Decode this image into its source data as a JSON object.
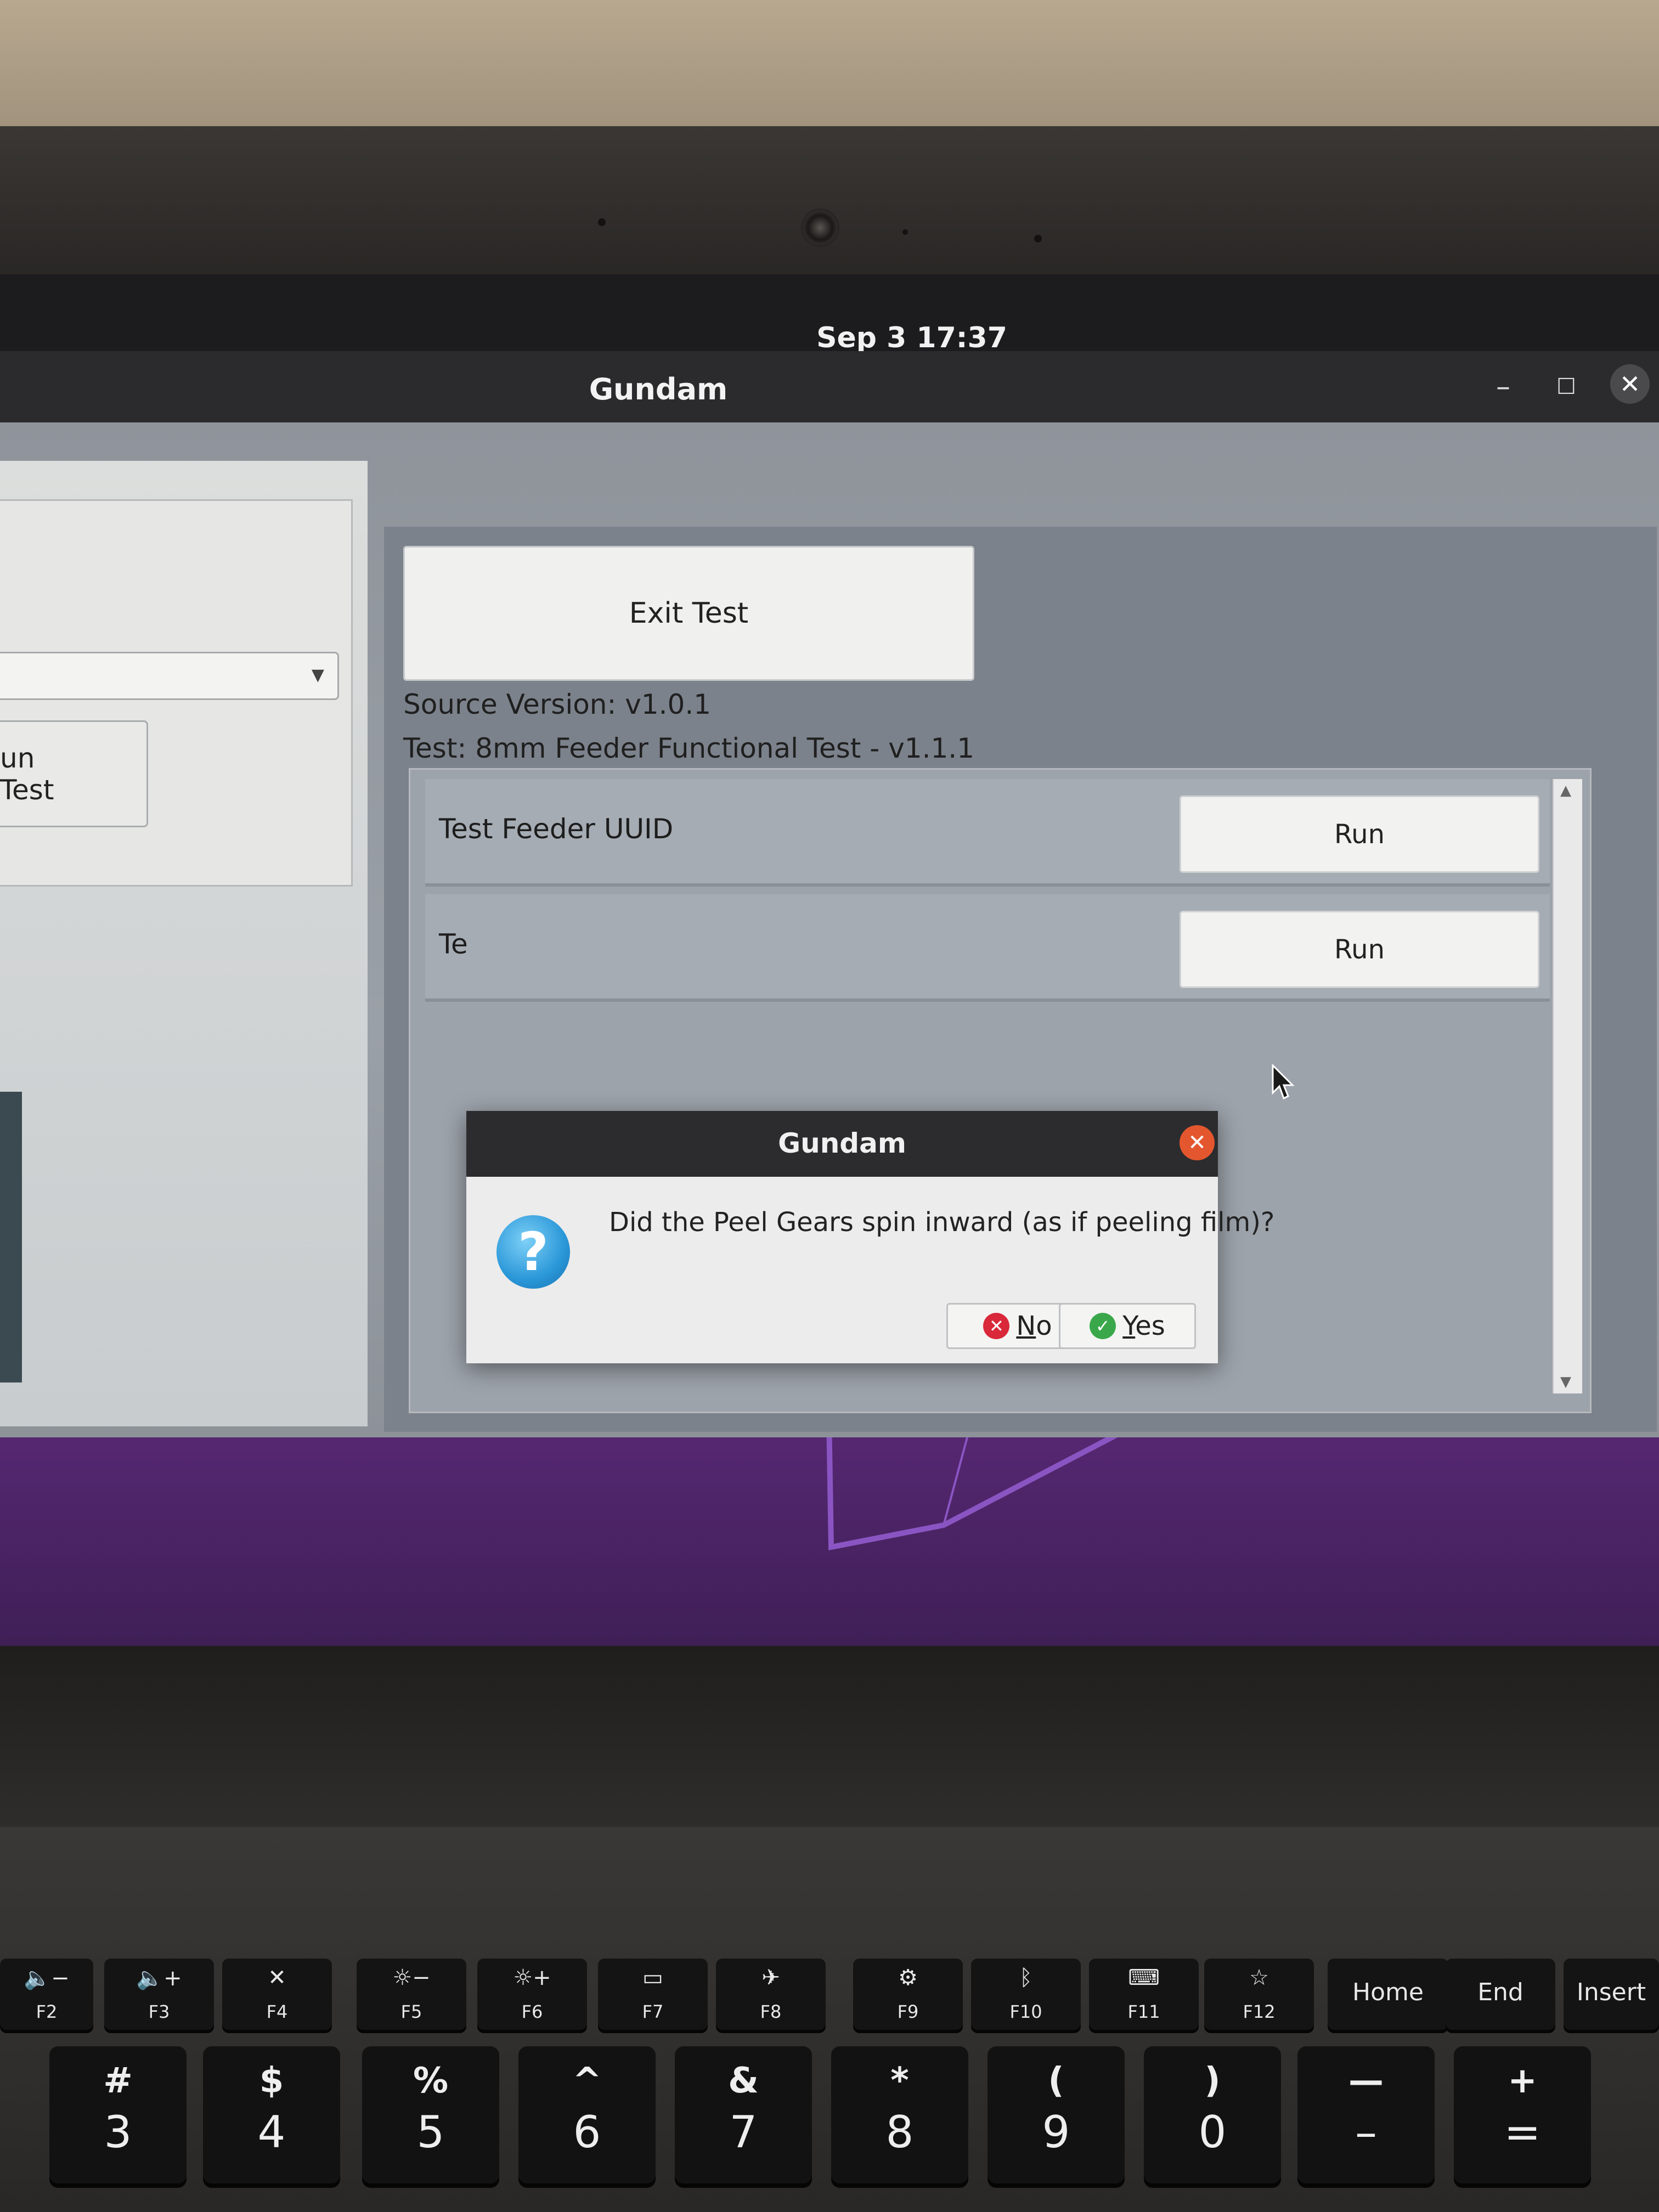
{
  "system": {
    "clock": "Sep 3  17:37"
  },
  "window": {
    "title": "Gundam",
    "controls": {
      "minimize": "–",
      "maximize": "☐",
      "close": "✕"
    }
  },
  "left_panel": {
    "run_test_label": "un Test"
  },
  "right_panel": {
    "exit_button": "Exit Test",
    "source_version": "Source Version: v1.0.1",
    "test_name": "Test: 8mm Feeder Functional Test - v1.1.1",
    "tests": [
      {
        "label": "Test Feeder UUID",
        "button": "Run"
      },
      {
        "label": "Te",
        "button": "Run"
      }
    ]
  },
  "dialog": {
    "title": "Gundam",
    "message": "Did the Peel Gears spin inward (as if peeling film)?",
    "no_button": {
      "mnemonic": "N",
      "rest": "o"
    },
    "yes_button": {
      "mnemonic": "Y",
      "rest": "es"
    }
  },
  "keyboard": {
    "function_keys": [
      {
        "icon": "🔈−",
        "label": "F2"
      },
      {
        "icon": "🔈+",
        "label": "F3"
      },
      {
        "icon": "✕",
        "label": "F4"
      },
      {
        "icon": "☼−",
        "label": "F5"
      },
      {
        "icon": "☼+",
        "label": "F6"
      },
      {
        "icon": "▭",
        "label": "F7"
      },
      {
        "icon": "✈",
        "label": "F8"
      },
      {
        "icon": "⚙",
        "label": "F9"
      },
      {
        "icon": "ᛒ",
        "label": "F10"
      },
      {
        "icon": "⌨",
        "label": "F11"
      },
      {
        "icon": "☆",
        "label": "F12"
      }
    ],
    "nav_keys": [
      "Home",
      "End",
      "Insert"
    ],
    "number_keys": [
      {
        "shift": "#",
        "main": "3"
      },
      {
        "shift": "$",
        "main": "4"
      },
      {
        "shift": "%",
        "main": "5"
      },
      {
        "shift": "^",
        "main": "6"
      },
      {
        "shift": "&",
        "main": "7"
      },
      {
        "shift": "*",
        "main": "8"
      },
      {
        "shift": "(",
        "main": "9"
      },
      {
        "shift": ")",
        "main": "0"
      },
      {
        "shift": "—",
        "main": "–"
      },
      {
        "shift": "+",
        "main": "="
      }
    ]
  },
  "colors": {
    "dialog_close": "#e4572e",
    "question_icon": "#2a97d8",
    "no_icon": "#d9283a",
    "yes_icon": "#3aa84a",
    "wallpaper": "#6b3e96"
  }
}
